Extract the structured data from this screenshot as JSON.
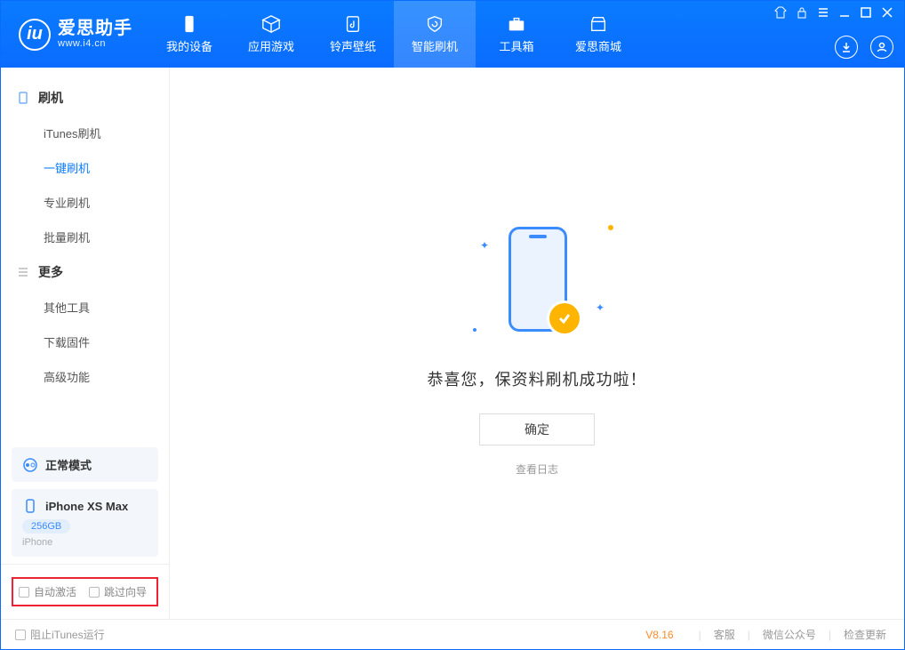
{
  "app": {
    "name": "爱思助手",
    "url": "www.i4.cn"
  },
  "nav": {
    "items": [
      {
        "label": "我的设备"
      },
      {
        "label": "应用游戏"
      },
      {
        "label": "铃声壁纸"
      },
      {
        "label": "智能刷机"
      },
      {
        "label": "工具箱"
      },
      {
        "label": "爱思商城"
      }
    ]
  },
  "sidebar": {
    "group1": {
      "title": "刷机",
      "items": [
        {
          "label": "iTunes刷机"
        },
        {
          "label": "一键刷机"
        },
        {
          "label": "专业刷机"
        },
        {
          "label": "批量刷机"
        }
      ]
    },
    "group2": {
      "title": "更多",
      "items": [
        {
          "label": "其他工具"
        },
        {
          "label": "下载固件"
        },
        {
          "label": "高级功能"
        }
      ]
    },
    "mode_card": {
      "label": "正常模式"
    },
    "device_card": {
      "name": "iPhone XS Max",
      "capacity": "256GB",
      "type": "iPhone"
    },
    "opts": {
      "auto_activate": "自动激活",
      "skip_guide": "跳过向导"
    }
  },
  "main": {
    "success_text": "恭喜您，保资料刷机成功啦！",
    "ok_button": "确定",
    "view_log": "查看日志"
  },
  "footer": {
    "block_itunes": "阻止iTunes运行",
    "version": "V8.16",
    "links": {
      "service": "客服",
      "wechat": "微信公众号",
      "update": "检查更新"
    }
  }
}
